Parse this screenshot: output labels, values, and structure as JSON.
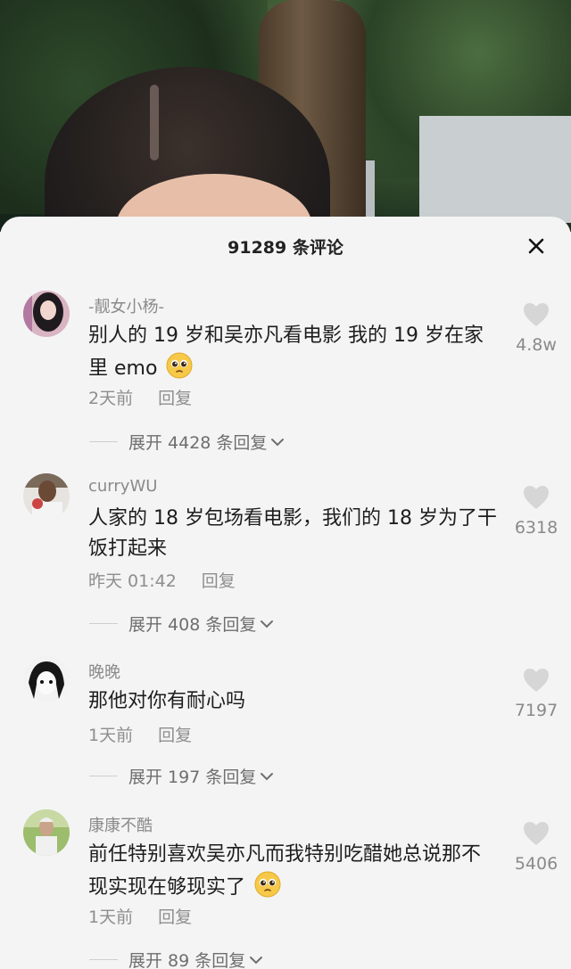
{
  "sheet": {
    "title": "91289 条评论",
    "close_icon": "close-icon"
  },
  "comments": [
    {
      "username": "-靓女小杨-",
      "text": "别人的 19 岁和吴亦凡看电影 我的 19 岁在家里 emo",
      "emoji": "pleading-face-emoji",
      "time": "2天前",
      "reply_label": "回复",
      "expand_label": "展开 4428 条回复",
      "likes": "4.8w"
    },
    {
      "username": "curryWU",
      "text": "人家的 18 岁包场看电影，我们的 18 岁为了干饭打起来",
      "emoji": "",
      "time": "昨天 01:42",
      "reply_label": "回复",
      "expand_label": "展开 408 条回复",
      "likes": "6318"
    },
    {
      "username": "晚晚",
      "text": "那他对你有耐心吗",
      "emoji": "",
      "time": "1天前",
      "reply_label": "回复",
      "expand_label": "展开 197 条回复",
      "likes": "7197"
    },
    {
      "username": "康康不酷",
      "text": "前任特别喜欢吴亦凡而我特别吃醋她总说那不现实现在够现实了",
      "emoji": "pleading-face-emoji",
      "time": "1天前",
      "reply_label": "回复",
      "expand_label": "展开 89 条回复",
      "likes": "5406"
    }
  ],
  "colors": {
    "sheet_bg": "#f4f4f4",
    "text": "#1d1d1d",
    "muted": "#8a8a8a",
    "heart": "#d6d6d6"
  }
}
